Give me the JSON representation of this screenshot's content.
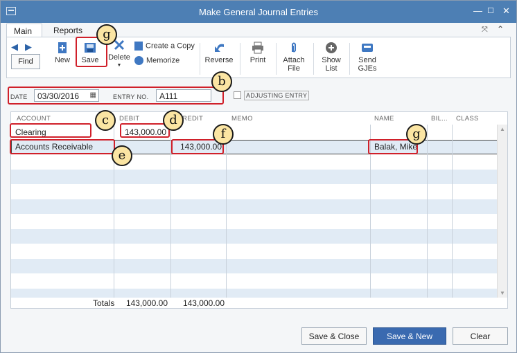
{
  "window": {
    "title": "Make General Journal Entries"
  },
  "tabs": [
    "Main",
    "Reports"
  ],
  "toolbar": {
    "find": "Find",
    "new": "New",
    "save": "Save",
    "delete": "Delete",
    "create_copy": "Create a Copy",
    "memorize": "Memorize",
    "reverse": "Reverse",
    "print": "Print",
    "attach_file_1": "Attach",
    "attach_file_2": "File",
    "show_list_1": "Show",
    "show_list_2": "List",
    "send_gjes_1": "Send",
    "send_gjes_2": "GJEs"
  },
  "header": {
    "date_label": "DATE",
    "date_value": "03/30/2016",
    "entry_no_label": "ENTRY NO.",
    "entry_no_value": "A111",
    "adjusting_label": "ADJUSTING ENTRY"
  },
  "columns": {
    "account": "ACCOUNT",
    "debit": "DEBIT",
    "credit": "CREDIT",
    "memo": "MEMO",
    "name": "NAME",
    "billable": "BIL...",
    "class": "CLASS"
  },
  "rows": [
    {
      "account": "Clearing",
      "debit": "143,000.00",
      "credit": "",
      "memo": "",
      "name": ""
    },
    {
      "account": "Accounts Receivable",
      "debit": "",
      "credit": "143,000.00",
      "memo": "",
      "name": "Balak, Mike"
    }
  ],
  "totals": {
    "label": "Totals",
    "debit": "143,000.00",
    "credit": "143,000.00"
  },
  "buttons": {
    "save_close": "Save & Close",
    "save_new": "Save & New",
    "clear": "Clear"
  },
  "callouts": [
    "g",
    "b",
    "c",
    "d",
    "e",
    "f",
    "g"
  ],
  "colors": {
    "titlebar": "#4d7fb4",
    "highlight": "#d0202a",
    "badge": "#fbe5a3",
    "row_alt": "#e1ebf5"
  }
}
